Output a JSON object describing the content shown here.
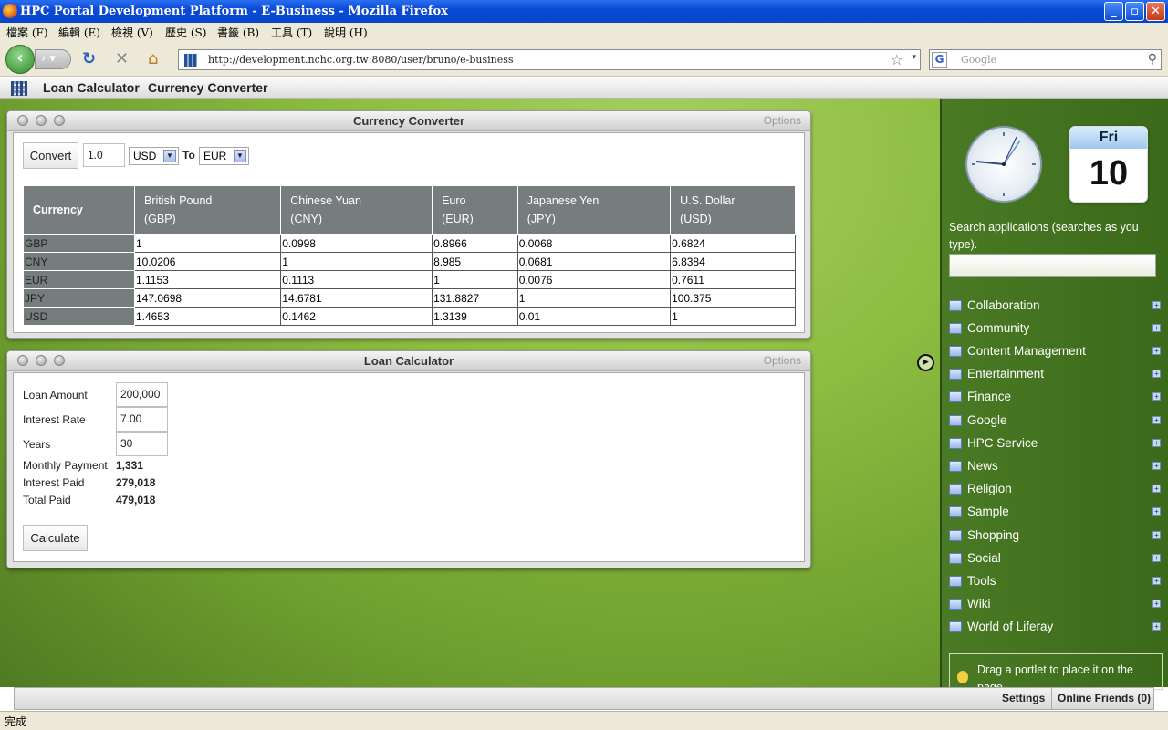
{
  "window": {
    "title": "HPC Portal Development Platform - E-Business - Mozilla Firefox"
  },
  "menu": [
    "檔案 (F)",
    "編輯 (E)",
    "檢視 (V)",
    "歷史 (S)",
    "書籤 (B)",
    "工具 (T)",
    "說明 (H)"
  ],
  "nav": {
    "url": "http://development.nchc.org.tw:8080/user/bruno/e-business",
    "search_placeholder": "Google"
  },
  "dock": {
    "links": [
      "Loan Calculator",
      "Currency Converter"
    ]
  },
  "currency": {
    "title": "Currency Converter",
    "options": "Options",
    "convert_label": "Convert",
    "amount": "1.0",
    "from": "USD",
    "to_label": "To",
    "to": "EUR",
    "headers": [
      [
        "Currency",
        ""
      ],
      [
        "British Pound",
        "(GBP)"
      ],
      [
        "Chinese Yuan",
        "(CNY)"
      ],
      [
        "Euro",
        "(EUR)"
      ],
      [
        "Japanese Yen",
        "(JPY)"
      ],
      [
        "U.S. Dollar",
        "(USD)"
      ]
    ],
    "rows": [
      [
        "GBP",
        "1",
        "0.0998",
        "0.8966",
        "0.0068",
        "0.6824"
      ],
      [
        "CNY",
        "10.0206",
        "1",
        "8.985",
        "0.0681",
        "6.8384"
      ],
      [
        "EUR",
        "1.1153",
        "0.1113",
        "1",
        "0.0076",
        "0.7611"
      ],
      [
        "JPY",
        "147.0698",
        "14.6781",
        "131.8827",
        "1",
        "100.375"
      ],
      [
        "USD",
        "1.4653",
        "0.1462",
        "1.3139",
        "0.01",
        "1"
      ]
    ]
  },
  "loan": {
    "title": "Loan Calculator",
    "options": "Options",
    "amount_label": "Loan Amount",
    "amount": "200,000",
    "rate_label": "Interest Rate",
    "rate": "7.00",
    "years_label": "Years",
    "years": "30",
    "monthly_label": "Monthly Payment",
    "monthly": "1,331",
    "interest_label": "Interest Paid",
    "interest": "279,018",
    "total_label": "Total Paid",
    "total": "479,018",
    "calculate_label": "Calculate"
  },
  "sidebar": {
    "calendar_day": "Fri",
    "calendar_date": "10",
    "search_label": "Search applications (searches as you type).",
    "categories": [
      "Collaboration",
      "Community",
      "Content Management",
      "Entertainment",
      "Finance",
      "Google",
      "HPC Service",
      "News",
      "Religion",
      "Sample",
      "Shopping",
      "Social",
      "Tools",
      "Wiki",
      "World of Liferay"
    ],
    "drag_hint": "Drag a portlet to place it on the page."
  },
  "bottom": {
    "settings": "Settings",
    "friends": "Online Friends (0)"
  },
  "status": "完成"
}
